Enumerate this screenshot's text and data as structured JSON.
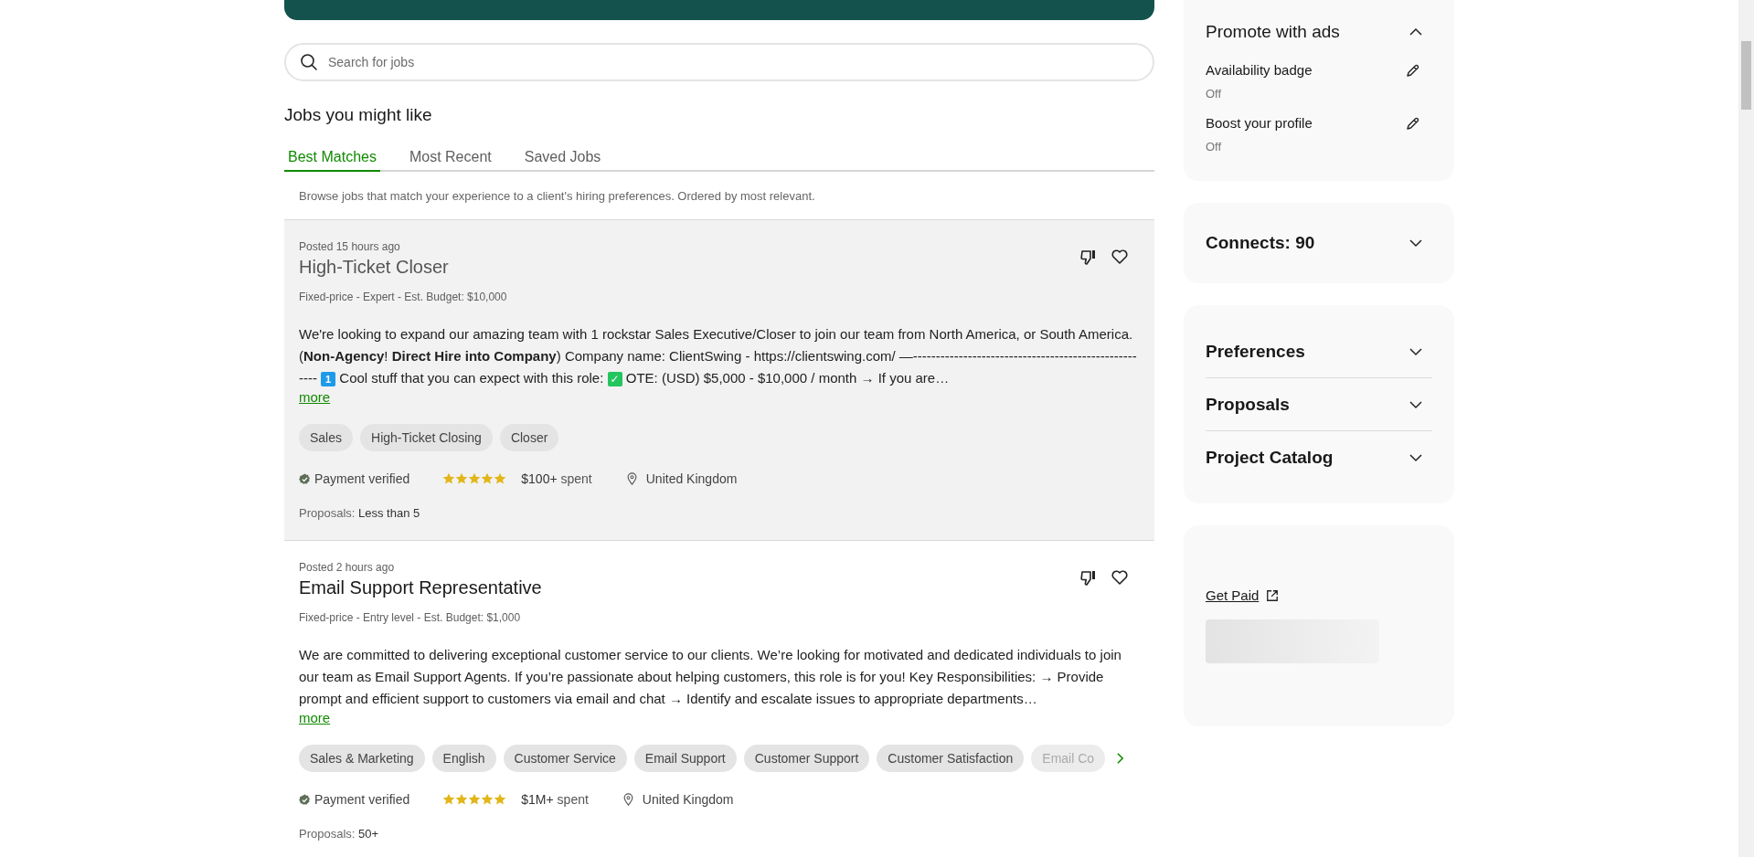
{
  "search": {
    "placeholder": "Search for jobs"
  },
  "heading": "Jobs you might like",
  "tabs": [
    {
      "label": "Best Matches",
      "selected": true
    },
    {
      "label": "Most Recent",
      "selected": false
    },
    {
      "label": "Saved Jobs",
      "selected": false
    }
  ],
  "tab_description": "Browse jobs that match your experience to a client's hiring preferences. Ordered by most relevant.",
  "jobs": [
    {
      "posted": "Posted 15 hours ago",
      "title": "High-Ticket Closer",
      "highlighted": true,
      "terms": "Fixed-price - Expert - Est. Budget: $10,000",
      "description": [
        {
          "kind": "text",
          "text": "We're looking to expand our amazing team with 1 rockstar Sales Executive/Closer to join our team from North America, or South America. (**Non-Agency**! **Direct Hire into Company**) Company name: ClientSwing - https://clientswing.com/ —-----------------------------------------------------"
        },
        {
          "kind": "keycap",
          "text": "1"
        },
        {
          "kind": "text",
          "text": "Cool stuff that you can expect with this role:"
        },
        {
          "kind": "checkbox",
          "text": "✓"
        },
        {
          "kind": "text",
          "text": "OTE: (USD) $5,000 - $10,000 / month → If you are…"
        }
      ],
      "more": "more",
      "skills": [
        "Sales",
        "High-Ticket Closing",
        "Closer"
      ],
      "skills_more": false,
      "payment": "Payment verified",
      "stars": 5,
      "spent_amount": "$100+",
      "spent_label": "spent",
      "location": "United Kingdom",
      "proposals_label": "Proposals:",
      "proposals": "Less than 5"
    },
    {
      "posted": "Posted 2 hours ago",
      "title": "Email Support Representative",
      "highlighted": false,
      "terms": "Fixed-price - Entry level - Est. Budget: $1,000",
      "description": [
        {
          "kind": "text",
          "text": "We are committed to delivering exceptional customer service to our clients. We’re looking for motivated and dedicated individuals to join our team as Email Support Agents. If you’re passionate about helping customers, this role is for you! Key Responsibilities: → Provide prompt and efficient support to customers via email and chat → Identify and escalate issues to appropriate departments…"
        }
      ],
      "more": "more",
      "skills": [
        "Sales & Marketing",
        "English",
        "Customer Service",
        "Email Support",
        "Customer Support",
        "Customer Satisfaction",
        "Email Co"
      ],
      "skills_more": true,
      "payment": "Payment verified",
      "stars": 5,
      "spent_amount": "$1M+",
      "spent_label": "spent",
      "location": "United Kingdom",
      "proposals_label": "Proposals:",
      "proposals": "50+"
    }
  ],
  "promote": {
    "title": "Promote with ads",
    "expanded": true,
    "items": [
      {
        "label": "Availability badge",
        "value": "Off"
      },
      {
        "label": "Boost your profile",
        "value": "Off"
      }
    ]
  },
  "connects": {
    "title": "Connects: 90",
    "expanded": false
  },
  "sections": [
    {
      "title": "Preferences",
      "expanded": false
    },
    {
      "title": "Proposals",
      "expanded": false
    },
    {
      "title": "Project Catalog",
      "expanded": false
    }
  ],
  "links": [
    {
      "label": "Get Paid"
    }
  ]
}
